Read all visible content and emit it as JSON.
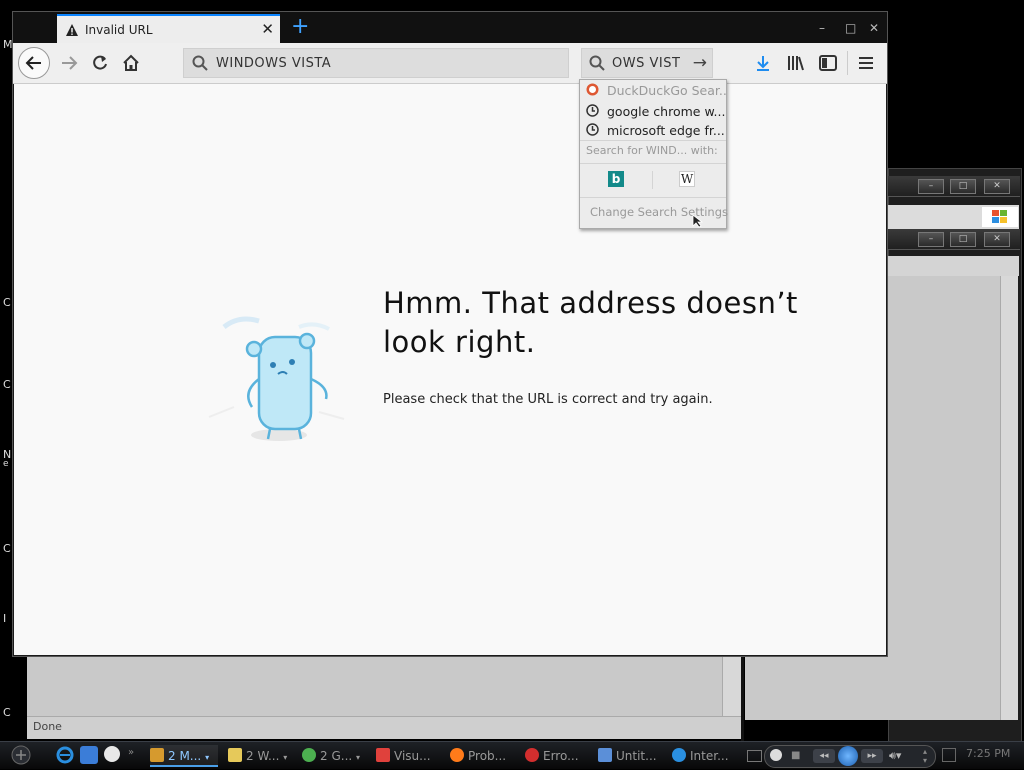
{
  "desktop": {
    "edge_letters": [
      "M",
      "C",
      "C",
      "N",
      "e",
      "C",
      "I",
      "C"
    ]
  },
  "tab": {
    "title": "Invalid URL",
    "new_tab_icon": "plus-icon"
  },
  "navbar": {
    "url_value": "WINDOWS VISTA",
    "search_value": "OWS VIST"
  },
  "dropdown": {
    "suggestions": [
      {
        "label": "DuckDuckGo Sear...",
        "icon": "duckduckgo-icon"
      },
      {
        "label": "google chrome w...",
        "icon": "history-icon"
      },
      {
        "label": "microsoft edge fr...",
        "icon": "history-icon"
      }
    ],
    "search_for_hint": "Search for WIND... with:",
    "engines": [
      {
        "name": "Bing",
        "glyph": "b",
        "color": "#138a8a"
      },
      {
        "name": "Wikipedia",
        "glyph": "W",
        "color": "#222222"
      }
    ],
    "settings_label": "Change Search Settings"
  },
  "error_page": {
    "title": "Hmm. That address doesn’t look right.",
    "description": "Please check that the URL is correct and try again."
  },
  "background_window": {
    "status_text": "Done"
  },
  "taskbar": {
    "items": [
      {
        "label": "2 M...",
        "color": "#d69a2e",
        "active": true
      },
      {
        "label": "2 W...",
        "color": "#e6c95a"
      },
      {
        "label": "2 G...",
        "color": "#4caf50"
      },
      {
        "label": "Visu...",
        "color": "#e0413c"
      },
      {
        "label": "Prob...",
        "color": "#ff7b1a"
      },
      {
        "label": "Erro...",
        "color": "#d22e2e"
      },
      {
        "label": "Untit...",
        "color": "#5b8fd8"
      },
      {
        "label": "Inter...",
        "color": "#2a8fe0"
      }
    ],
    "clock": "7:25 PM"
  }
}
